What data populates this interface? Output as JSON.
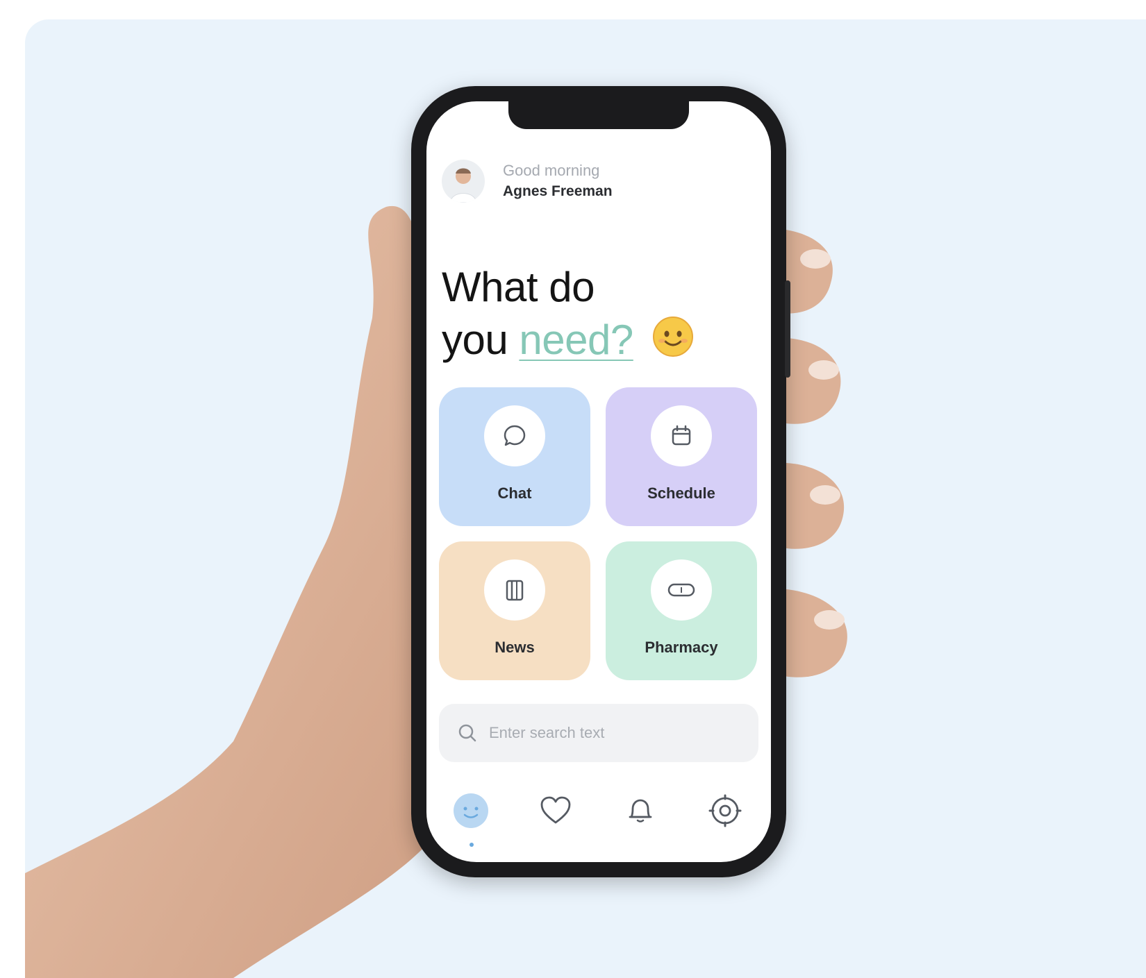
{
  "app": {
    "greeting": "Good morning",
    "user_name": "Agnes Freeman",
    "headline_line1": "What do",
    "headline_line2_prefix": "you",
    "headline_accent": "need?"
  },
  "tiles": [
    {
      "label": "Chat",
      "icon": "chat-bubble-icon",
      "color": "#c7ddf8"
    },
    {
      "label": "Schedule",
      "icon": "calendar-icon",
      "color": "#d6cff7"
    },
    {
      "label": "News",
      "icon": "book-icon",
      "color": "#f6dfc3"
    },
    {
      "label": "Pharmacy",
      "icon": "pill-icon",
      "color": "#cbeedf"
    }
  ],
  "search": {
    "placeholder": "Enter search text",
    "icon": "search-icon"
  },
  "tabbar": {
    "items": [
      {
        "icon": "home-face-icon",
        "active": true
      },
      {
        "icon": "heart-icon",
        "active": false
      },
      {
        "icon": "bell-icon",
        "active": false
      },
      {
        "icon": "settings-icon",
        "active": false
      }
    ]
  },
  "colors": {
    "background": "#eaf3fb",
    "accent": "#86c7b6",
    "active_tab": "#6aa9de"
  }
}
